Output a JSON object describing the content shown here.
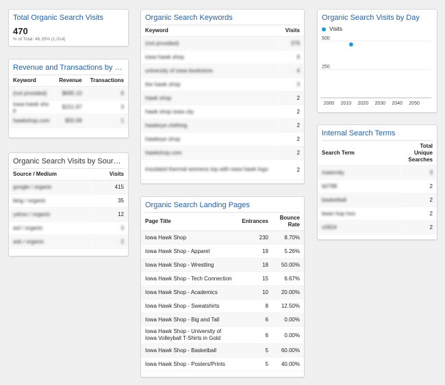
{
  "total_visits": {
    "title": "Total Organic Search Visits",
    "value": "470",
    "note": "% of Total: 46.35% (1,014)"
  },
  "revenue": {
    "title": "Revenue and Transactions by Keyword",
    "headers": [
      "Keyword",
      "Revenue",
      "Transactions"
    ],
    "rows": [
      {
        "keyword": "(not provided)",
        "revenue": "$695.10",
        "transactions": "6"
      },
      {
        "keyword": "iowa hawk sho p",
        "revenue": "$151.97",
        "transactions": "3"
      },
      {
        "keyword": "hawkshop.com",
        "revenue": "$50.99",
        "transactions": "1"
      }
    ]
  },
  "source_medium": {
    "title": "Organic Search Visits by Source / M...",
    "headers": [
      "Source / Medium",
      "Visits"
    ],
    "rows": [
      {
        "source": "google / organic",
        "visits": "415"
      },
      {
        "source": "bing / organic",
        "visits": "35"
      },
      {
        "source": "yahoo / organic",
        "visits": "12"
      },
      {
        "source": "aol / organic",
        "visits": "3"
      },
      {
        "source": "ask / organic",
        "visits": "2"
      }
    ]
  },
  "keywords": {
    "title": "Organic Search Keywords",
    "headers": [
      "Keyword",
      "Visits"
    ],
    "rows": [
      {
        "keyword": "(not provided)",
        "visits": "379"
      },
      {
        "keyword": "iowa hawk shop",
        "visits": "9"
      },
      {
        "keyword": "university of iowa bookstore",
        "visits": "4"
      },
      {
        "keyword": "the hawk shop",
        "visits": "3"
      },
      {
        "keyword": "hawk shop",
        "visits": "2"
      },
      {
        "keyword": "hawk shop iowa city",
        "visits": "2"
      },
      {
        "keyword": "hawkeye clothing",
        "visits": "2"
      },
      {
        "keyword": "hawkeye shop",
        "visits": "2"
      },
      {
        "keyword": "hawkshop.com",
        "visits": "2"
      },
      {
        "keyword": "insulated thermal womens top with iowa hawk logo",
        "visits": "2"
      }
    ]
  },
  "landing": {
    "title": "Organic Search Landing Pages",
    "headers": [
      "Page Title",
      "Entrances",
      "Bounce Rate"
    ],
    "rows": [
      {
        "page": "Iowa Hawk Shop",
        "entrances": "230",
        "bounce": "8.70%"
      },
      {
        "page": "Iowa Hawk Shop - Apparel",
        "entrances": "19",
        "bounce": "5.26%"
      },
      {
        "page": "Iowa Hawk Shop - Wrestling",
        "entrances": "18",
        "bounce": "50.00%"
      },
      {
        "page": "Iowa Hawk Shop - Tech Connection",
        "entrances": "15",
        "bounce": "6.67%"
      },
      {
        "page": "Iowa Hawk Shop - Academics",
        "entrances": "10",
        "bounce": "20.00%"
      },
      {
        "page": "Iowa Hawk Shop - Sweatshirts",
        "entrances": "8",
        "bounce": "12.50%"
      },
      {
        "page": "Iowa Hawk Shop - Big and Tall",
        "entrances": "6",
        "bounce": "0.00%"
      },
      {
        "page": "Iowa Hawk Shop - University of Iowa Volleyball T-Shirts in Gold",
        "entrances": "6",
        "bounce": "0.00%"
      },
      {
        "page": "Iowa Hawk Shop - Basketball",
        "entrances": "5",
        "bounce": "60.00%"
      },
      {
        "page": "Iowa Hawk Shop - Posters/Prints",
        "entrances": "5",
        "bounce": "40.00%"
      }
    ]
  },
  "visits_by_day": {
    "title": "Organic Search Visits by Day",
    "legend": "Visits",
    "accent": "#1f9ad6"
  },
  "chart_data": {
    "type": "scatter",
    "title": "Organic Search Visits by Day",
    "series": [
      {
        "name": "Visits",
        "x": [
          2013
        ],
        "y": [
          470
        ]
      }
    ],
    "xlim": [
      1995,
      2060
    ],
    "ylim": [
      0,
      530
    ],
    "x_ticks": [
      "2000",
      "2010",
      "2020",
      "2030",
      "2040",
      "2050"
    ],
    "y_ticks": [
      "500",
      "250"
    ]
  },
  "internal_search": {
    "title": "Internal Search Terms",
    "headers": [
      "Search Term",
      "Total Unique Searches"
    ],
    "rows": [
      {
        "term": "maternity",
        "count": "3"
      },
      {
        "term": "b0788",
        "count": "2"
      },
      {
        "term": "basketball",
        "count": "2"
      },
      {
        "term": "bean hop hoo",
        "count": "2"
      },
      {
        "term": "c0924",
        "count": "2"
      }
    ]
  }
}
